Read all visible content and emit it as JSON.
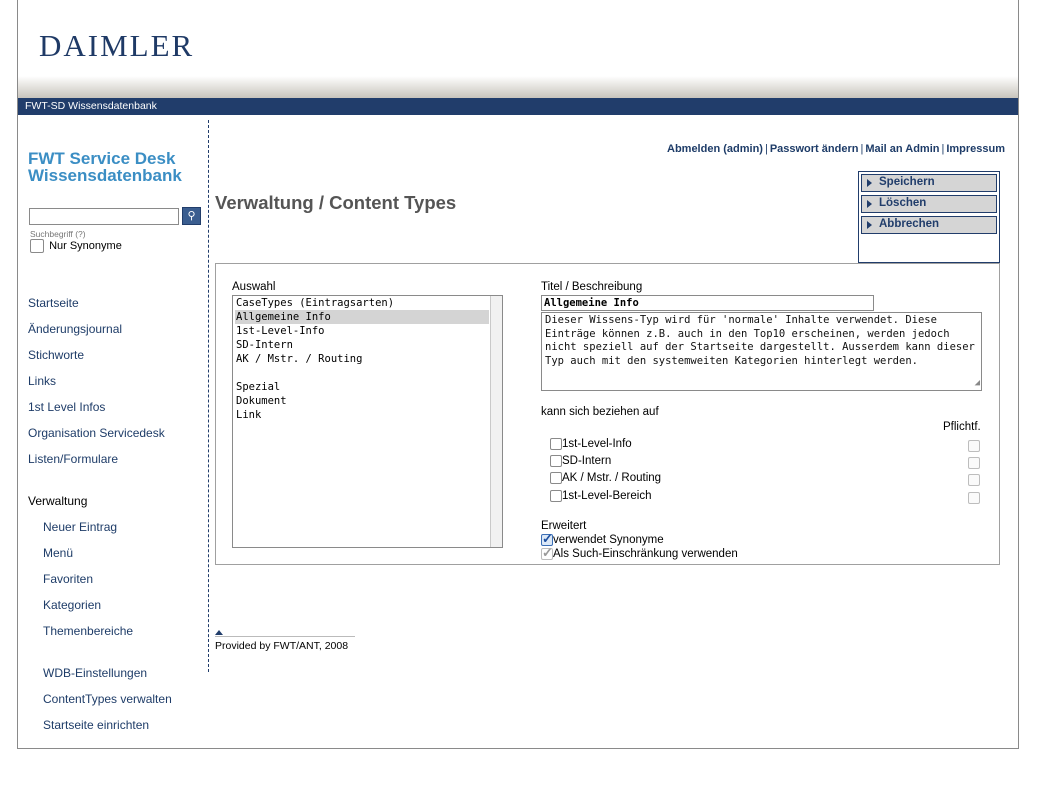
{
  "brand": {
    "logo_text": "DAIMLER",
    "nav_band": "FWT-SD Wissensdatenbank"
  },
  "sidebar": {
    "title_line1": "FWT Service Desk",
    "title_line2": "Wissensdatenbank",
    "search": {
      "value": "",
      "hint": "Suchbegriff (?)"
    },
    "only_synonyms": {
      "label": "Nur Synonyme",
      "checked": false
    },
    "nav": [
      "Startseite",
      "Änderungsjournal",
      "Stichworte",
      "Links",
      "1st Level Infos",
      "Organisation Servicedesk",
      "Listen/Formulare"
    ],
    "admin_title": "Verwaltung",
    "admin": [
      "Neuer Eintrag",
      "Menü",
      "Favoriten",
      "Kategorien",
      "Themenbereiche"
    ],
    "settings": [
      "WDB-Einstellungen",
      "ContentTypes verwalten",
      "Startseite einrichten"
    ]
  },
  "toplinks": [
    "Abmelden (admin)",
    "Passwort ändern",
    "Mail an Admin",
    "Impressum"
  ],
  "toplinks_sep": "|",
  "page_title": "Verwaltung / Content Types",
  "actions": {
    "save": "Speichern",
    "delete": "Löschen",
    "cancel": "Abbrechen"
  },
  "form": {
    "selection_label": "Auswahl",
    "options": [
      "CaseTypes (Eintragsarten)",
      "Allgemeine Info",
      "1st-Level-Info",
      "SD-Intern",
      "AK / Mstr. / Routing",
      "",
      "Spezial",
      "Dokument",
      "Link"
    ],
    "selected_option": "Allgemeine Info",
    "title_label": "Titel / Beschreibung",
    "title_value": "Allgemeine Info",
    "description": "Dieser Wissens-Typ wird für 'normale' Inhalte verwendet. Diese Einträge können z.B. auch in den Top10 erscheinen, werden jedoch nicht speziell auf der Startseite dargestellt. Ausserdem kann dieser Typ auch mit den systemweiten Kategorien hinterlegt werden.",
    "relates_label": "kann sich beziehen auf",
    "pflicht_label": "Pflichtf.",
    "relations": [
      {
        "label": "1st-Level-Info",
        "checked": false,
        "required": false
      },
      {
        "label": "SD-Intern",
        "checked": false,
        "required": false
      },
      {
        "label": "AK / Mstr. / Routing",
        "checked": false,
        "required": false
      },
      {
        "label": "1st-Level-Bereich",
        "checked": false,
        "required": false
      }
    ],
    "extended_label": "Erweitert",
    "uses_synonyms": {
      "label": "verwendet Synonyme",
      "checked": true
    },
    "search_restriction": {
      "label": "Als Such-Einschränkung verwenden",
      "checked": true,
      "disabled": true
    }
  },
  "footer": "Provided by FWT/ANT, 2008"
}
